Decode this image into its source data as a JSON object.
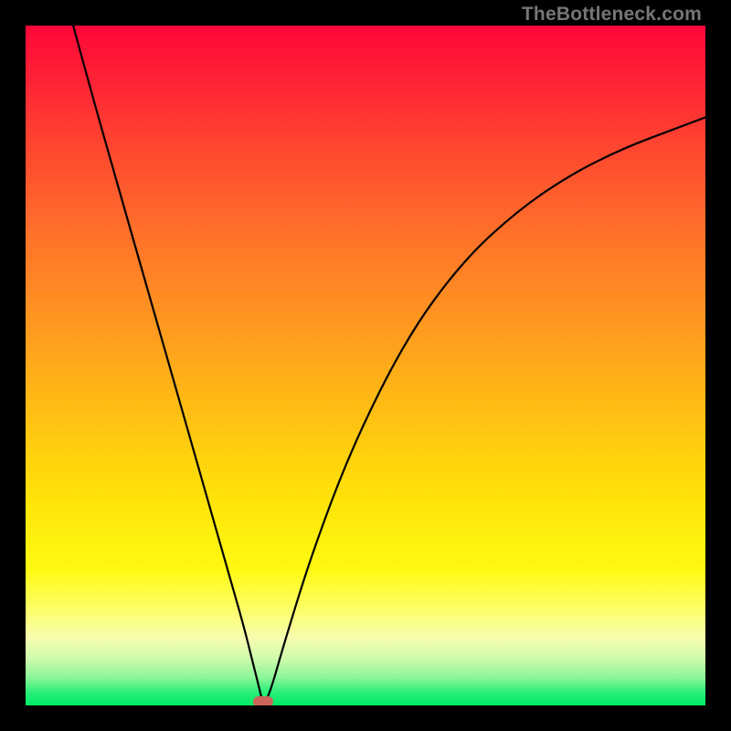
{
  "watermark": "TheBottleneck.com",
  "colors": {
    "frame": "#000000",
    "curve": "#000000",
    "marker": "#cb6559",
    "watermark": "#767676"
  },
  "chart_data": {
    "type": "line",
    "title": "",
    "xlabel": "",
    "ylabel": "",
    "xlim": [
      0,
      100
    ],
    "ylim": [
      0,
      100
    ],
    "grid": false,
    "series": [
      {
        "name": "bottleneck-curve",
        "x": [
          7,
          10,
          14,
          18,
          22,
          26,
          30,
          32,
          33.5,
          34.5,
          35,
          36,
          38,
          42,
          48,
          56,
          64,
          72,
          80,
          88,
          96,
          100
        ],
        "y": [
          100,
          89,
          75,
          61,
          47,
          33,
          19,
          12,
          6,
          2,
          0,
          2,
          9,
          22,
          38,
          54,
          65,
          72.5,
          78,
          82,
          85,
          86.5
        ]
      }
    ],
    "marker": {
      "x": 35,
      "y": 0.5
    },
    "legend": false
  }
}
